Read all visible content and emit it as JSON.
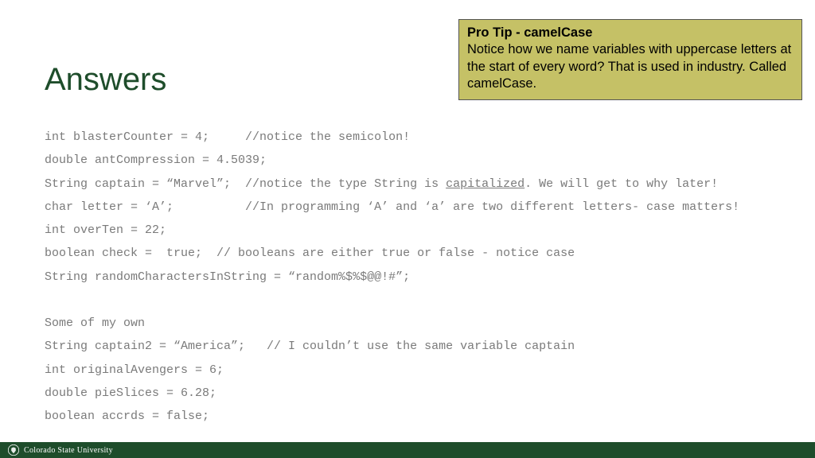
{
  "title": "Answers",
  "tip": {
    "heading": "Pro Tip - camelCase",
    "body": "Notice how we name variables with uppercase letters at the start of every word? That is used in industry. Called camelCase."
  },
  "code": {
    "l1a": "int blasterCounter = 4;     //notice the semicolon!",
    "l2a": "double antCompression = 4.5039;",
    "l3a": "String captain = “Marvel”;  //notice the type String is ",
    "l3u": "capitalized",
    "l3b": ". We will get to why later!",
    "l4a": "char letter = ‘A’;          //In programming ‘A’ and ‘a’ are two different letters- case matters!",
    "l5a": "int overTen = 22;",
    "l6a": "boolean check =  true;  // booleans are either true or false - notice case",
    "l7a": "String randomCharactersInString = “random%$%$@@!#”;",
    "blank": "",
    "l8a": "Some of my own",
    "l9a": "String captain2 = “America”;   // I couldn’t use the same variable captain",
    "l10a": "int originalAvengers = 6;",
    "l11a": "double pieSlices = 6.28;",
    "l12a": "boolean accrds = false;"
  },
  "footer": {
    "org": "Colorado State University"
  }
}
